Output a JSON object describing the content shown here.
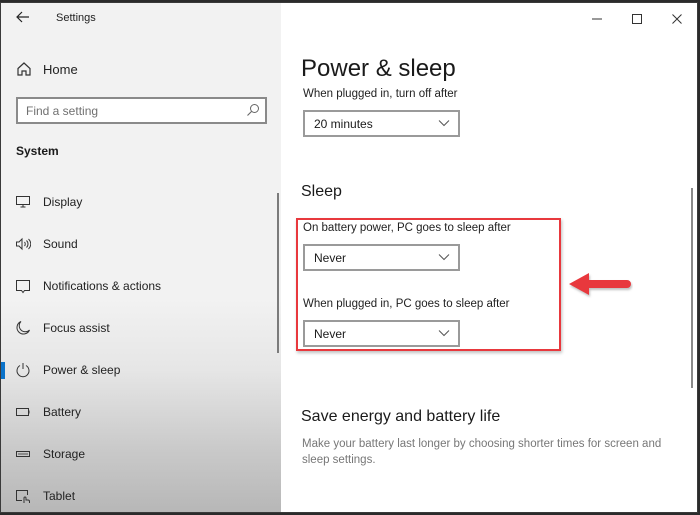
{
  "window": {
    "title": "Settings",
    "controls": {
      "minimize": "minimize",
      "maximize": "maximize",
      "close": "close"
    }
  },
  "sidebar": {
    "home_label": "Home",
    "search": {
      "placeholder": "Find a setting",
      "value": ""
    },
    "section_label": "System",
    "items": [
      {
        "label": "Display",
        "icon": "display-icon",
        "active": false
      },
      {
        "label": "Sound",
        "icon": "sound-icon",
        "active": false
      },
      {
        "label": "Notifications & actions",
        "icon": "notifications-icon",
        "active": false
      },
      {
        "label": "Focus assist",
        "icon": "moon-icon",
        "active": false
      },
      {
        "label": "Power & sleep",
        "icon": "power-icon",
        "active": true
      },
      {
        "label": "Battery",
        "icon": "battery-icon",
        "active": false
      },
      {
        "label": "Storage",
        "icon": "storage-icon",
        "active": false
      },
      {
        "label": "Tablet",
        "icon": "tablet-icon",
        "active": false
      }
    ]
  },
  "main": {
    "page_title": "Power & sleep",
    "screen": {
      "plugged_label": "When plugged in, turn off after",
      "plugged_value": "20 minutes"
    },
    "sleep": {
      "heading": "Sleep",
      "battery_label": "On battery power, PC goes to sleep after",
      "battery_value": "Never",
      "plugged_label": "When plugged in, PC goes to sleep after",
      "plugged_value": "Never"
    },
    "save_energy": {
      "heading": "Save energy and battery life",
      "description": "Make your battery last longer by choosing shorter times for screen and sleep settings."
    }
  },
  "annotation": {
    "highlight_color": "#e8383d",
    "arrow_color": "#e8383d"
  },
  "accent_color": "#0a72c9"
}
